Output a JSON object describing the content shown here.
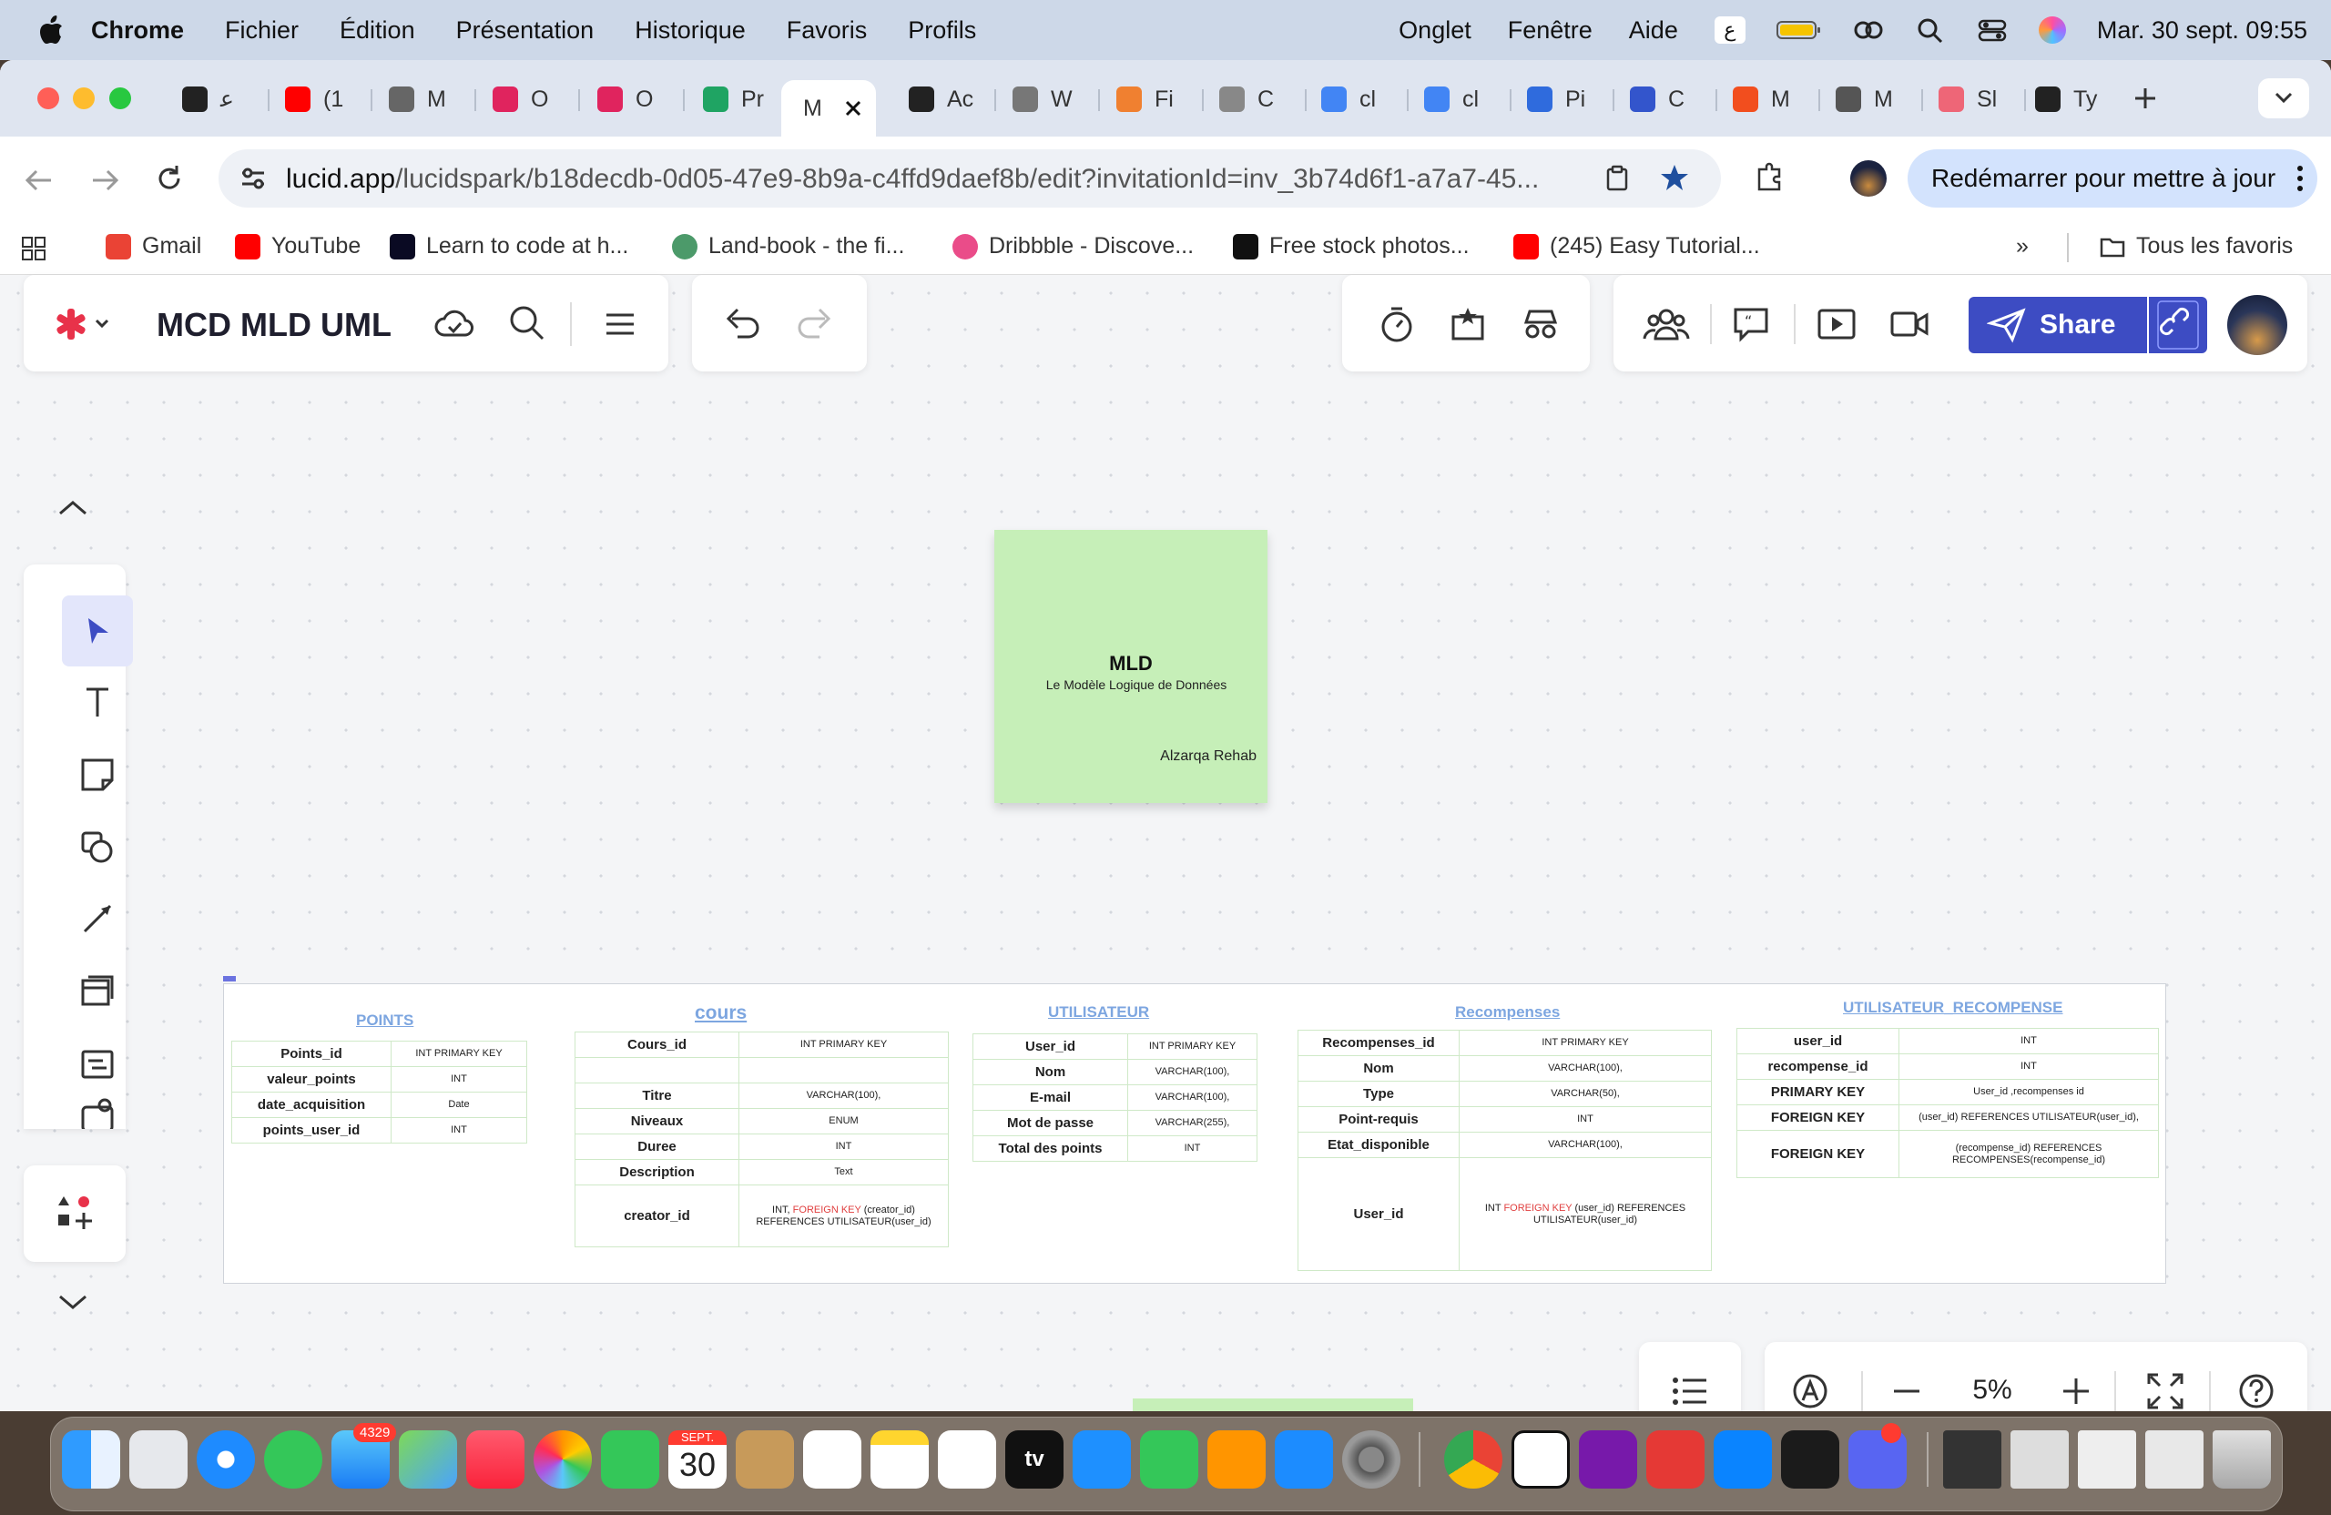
{
  "menubar": {
    "app": "Chrome",
    "items": [
      "Fichier",
      "Édition",
      "Présentation",
      "Historique",
      "Favoris",
      "Profils"
    ],
    "right_items": [
      "Onglet",
      "Fenêtre",
      "Aide"
    ],
    "input_indicator": "ع",
    "clock": "Mar. 30 sept.  09:55"
  },
  "tabs": [
    {
      "label": "ﻋ",
      "color": "#222"
    },
    {
      "label": "(1",
      "color": "#ff0000"
    },
    {
      "label": "M",
      "color": "#666"
    },
    {
      "label": "O",
      "color": "#e0245e"
    },
    {
      "label": "O",
      "color": "#e0245e"
    },
    {
      "label": "Pr",
      "color": "#1fa463"
    },
    {
      "label": "M",
      "color": "#fff",
      "active": true
    },
    {
      "label": "Ac",
      "color": "#222"
    },
    {
      "label": "W",
      "color": "#777"
    },
    {
      "label": "Fi",
      "color": "#f08030"
    },
    {
      "label": "C",
      "color": "#888"
    },
    {
      "label": "cl",
      "color": "#4285f4"
    },
    {
      "label": "cl",
      "color": "#4285f4"
    },
    {
      "label": "Pi",
      "color": "#2f6bdd"
    },
    {
      "label": "C",
      "color": "#3355cc"
    },
    {
      "label": "M",
      "color": "#f24e1e"
    },
    {
      "label": "M",
      "color": "#555"
    },
    {
      "label": "Sl",
      "color": "#e67"
    },
    {
      "label": "Ty",
      "color": "#222"
    }
  ],
  "address": {
    "host": "lucid.app",
    "path": "/lucidspark/b18decdb-0d05-47e9-8b9a-c4ffd9daef8b/edit?invitationId=inv_3b74d6f1-a7a7-45..."
  },
  "update_button": "Redémarrer pour mettre à jour",
  "bookmarks": [
    {
      "label": "Gmail",
      "color": "#ea4335"
    },
    {
      "label": "YouTube",
      "color": "#ff0000"
    },
    {
      "label": "Learn to code at h...",
      "color": "#0a0a23"
    },
    {
      "label": "Land-book - the fi...",
      "color": "#4c9a6a"
    },
    {
      "label": "Dribbble - Discove...",
      "color": "#ea4c89"
    },
    {
      "label": "Free stock photos...",
      "color": "#111"
    },
    {
      "label": "(245) Easy Tutorial...",
      "color": "#ff0000"
    }
  ],
  "bookmarks_more": "»",
  "bookmarks_all": "Tous les favoris",
  "lucid": {
    "doc_title": "MCD MLD UML",
    "share_label": "Share",
    "zoom": "5%"
  },
  "sticky": {
    "title": "MLD",
    "subtitle": "Le Modèle Logique de Données",
    "author": "Alzarqa Rehab"
  },
  "tables": {
    "points": {
      "title": "POINTS",
      "rows": [
        [
          "Points_id",
          "INT PRIMARY KEY"
        ],
        [
          "valeur_points",
          "INT"
        ],
        [
          "date_acquisition",
          "Date"
        ],
        [
          "points_user_id",
          "INT"
        ]
      ]
    },
    "cours": {
      "title": "cours",
      "rows": [
        [
          "Cours_id",
          "INT PRIMARY KEY"
        ],
        [
          "",
          ""
        ],
        [
          "Titre",
          "VARCHAR(100),"
        ],
        [
          "Niveaux",
          "ENUM"
        ],
        [
          "Duree",
          "INT"
        ],
        [
          "Description",
          "Text"
        ]
      ],
      "creator": {
        "key": "creator_id",
        "pre": "INT, ",
        "fk": "FOREIGN KEY",
        "post": " (creator_id) REFERENCES UTILISATEUR(user_id)"
      }
    },
    "utilisateur": {
      "title": "UTILISATEUR",
      "rows": [
        [
          "User_id",
          "INT PRIMARY KEY"
        ],
        [
          "Nom",
          "VARCHAR(100),"
        ],
        [
          "E-mail",
          "VARCHAR(100),"
        ],
        [
          "Mot de passe",
          "VARCHAR(255),"
        ],
        [
          "Total des points",
          "INT"
        ]
      ]
    },
    "recompenses": {
      "title": "Recompenses",
      "rows": [
        [
          "Recompenses_id",
          "INT PRIMARY KEY"
        ],
        [
          "Nom",
          "VARCHAR(100),"
        ],
        [
          "Type",
          "VARCHAR(50),"
        ],
        [
          "Point-requis",
          "INT"
        ],
        [
          "Etat_disponible",
          "VARCHAR(100),"
        ]
      ],
      "user": {
        "key": "User_id",
        "pre": "INT  ",
        "fk": "FOREIGN KEY",
        "post": " (user_id) REFERENCES UTILISATEUR(user_id)"
      }
    },
    "utilisateur_recompense": {
      "title": "UTILISATEUR_RECOMPENSE",
      "rows": [
        [
          "user_id",
          "INT"
        ],
        [
          "recompense_id",
          "INT"
        ],
        [
          "PRIMARY KEY",
          "User_id ,recompenses id"
        ],
        [
          "FOREIGN KEY",
          "(user_id) REFERENCES UTILISATEUR(user_id),"
        ],
        [
          "FOREIGN KEY",
          "(recompense_id) REFERENCES RECOMPENSES(recompense_id)"
        ]
      ]
    }
  },
  "dock": {
    "mail_badge": "4329",
    "calendar_month": "SEPT.",
    "calendar_day": "30",
    "appletv": "tv"
  }
}
